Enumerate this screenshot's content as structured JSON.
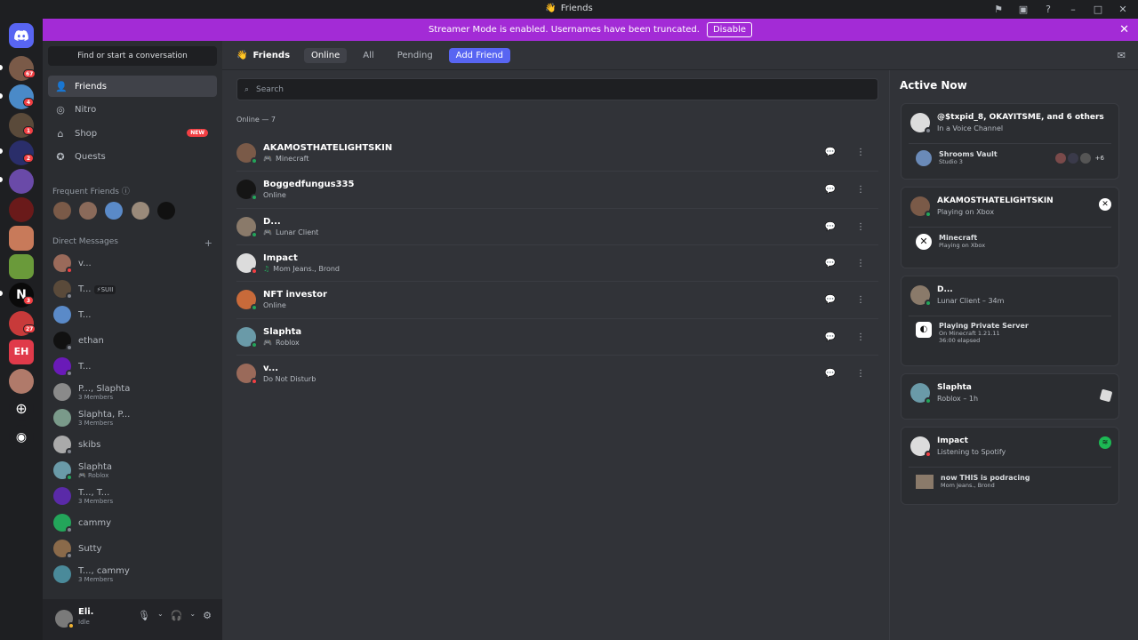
{
  "window": {
    "title": "Friends"
  },
  "banner": {
    "text": "Streamer Mode is enabled. Usernames have been truncated.",
    "button": "Disable"
  },
  "guilds": [
    {
      "badge": "67"
    },
    {
      "badge": "4"
    },
    {
      "badge": "1"
    },
    {
      "badge": "2"
    },
    {
      "badge": ""
    },
    {
      "badge": ""
    },
    {
      "badge": ""
    },
    {
      "badge": ""
    },
    {
      "badge": "3"
    },
    {
      "badge": "27"
    },
    {
      "badge": ""
    },
    {
      "badge": ""
    }
  ],
  "sidebar": {
    "find": "Find or start a conversation",
    "nav": [
      {
        "label": "Friends",
        "icon": "friends-icon"
      },
      {
        "label": "Nitro",
        "icon": "nitro-icon"
      },
      {
        "label": "Shop",
        "icon": "shop-icon",
        "badge": "NEW"
      },
      {
        "label": "Quests",
        "icon": "quests-icon"
      }
    ],
    "frequent_header": "Frequent Friends",
    "dm_header": "Direct Messages",
    "dms": [
      {
        "name": "v...",
        "sub": "",
        "status": "dnd"
      },
      {
        "name": "T...",
        "sub": "",
        "tag": "⚡SUII",
        "status": "off"
      },
      {
        "name": "T...",
        "sub": "",
        "status": ""
      },
      {
        "name": "ethan",
        "sub": "",
        "status": "off"
      },
      {
        "name": "T...",
        "sub": "",
        "status": "off"
      },
      {
        "name": "P..., Slaphta",
        "sub": "3 Members",
        "status": ""
      },
      {
        "name": "Slaphta, P...",
        "sub": "3 Members",
        "status": ""
      },
      {
        "name": "skibs",
        "sub": "",
        "status": "off"
      },
      {
        "name": "Slaphta",
        "sub": "Roblox",
        "status": "on"
      },
      {
        "name": "T..., T...",
        "sub": "3 Members",
        "status": ""
      },
      {
        "name": "cammy",
        "sub": "",
        "status": "off"
      },
      {
        "name": "Sutty",
        "sub": "",
        "status": "off"
      },
      {
        "name": "T..., cammy",
        "sub": "3 Members",
        "status": ""
      }
    ],
    "user": {
      "name": "Eli.",
      "status": "Idle"
    }
  },
  "topbar": {
    "title": "Friends",
    "tabs": [
      "Online",
      "All",
      "Pending"
    ],
    "add": "Add Friend"
  },
  "search": {
    "placeholder": "Search"
  },
  "online_label": "Online — 7",
  "friends": [
    {
      "name": "AKAMOSTHATELIGHTSKIN",
      "sub": "Minecraft",
      "status": "on",
      "activity": "game"
    },
    {
      "name": "Boggedfungus335",
      "sub": "Online",
      "status": "on",
      "activity": ""
    },
    {
      "name": "D...",
      "sub": "Lunar Client",
      "status": "on",
      "activity": "game"
    },
    {
      "name": "Impact",
      "sub": "Mom Jeans., Brond",
      "status": "dnd",
      "activity": "music"
    },
    {
      "name": "NFT investor",
      "sub": "Online",
      "status": "on",
      "activity": ""
    },
    {
      "name": "Slaphta",
      "sub": "Roblox",
      "status": "on",
      "activity": "game"
    },
    {
      "name": "v...",
      "sub": "Do Not Disturb",
      "status": "dnd",
      "activity": ""
    }
  ],
  "active_now": {
    "title": "Active Now",
    "cards": [
      {
        "title": "@$txpid_8, OKAYITSME, and 6 others",
        "sub": "In a Voice Channel",
        "inner_name": "Shrooms Vault",
        "inner_det": [
          "Studio 3"
        ],
        "extra": "+6"
      },
      {
        "title": "AKAMOSTHATELIGHTSKIN",
        "sub": "Playing on Xbox",
        "inner_name": "Minecraft",
        "inner_det": [
          "Playing on Xbox"
        ]
      },
      {
        "title": "D...",
        "sub": "Lunar Client – 34m",
        "inner_name": "Playing Private Server",
        "inner_det": [
          "On Minecraft 1.21.11",
          "36:00 elapsed"
        ]
      },
      {
        "title": "Slaphta",
        "sub": "Roblox – 1h"
      },
      {
        "title": "Impact",
        "sub": "Listening to Spotify",
        "inner_name": "now THIS is podracing",
        "inner_det": [
          "Mom Jeans., Brond"
        ]
      }
    ]
  },
  "colors": {
    "accent": "#5865f2",
    "banner": "#a32bd6",
    "online": "#23a55a",
    "dnd": "#f23f43",
    "spotify": "#1db954"
  }
}
